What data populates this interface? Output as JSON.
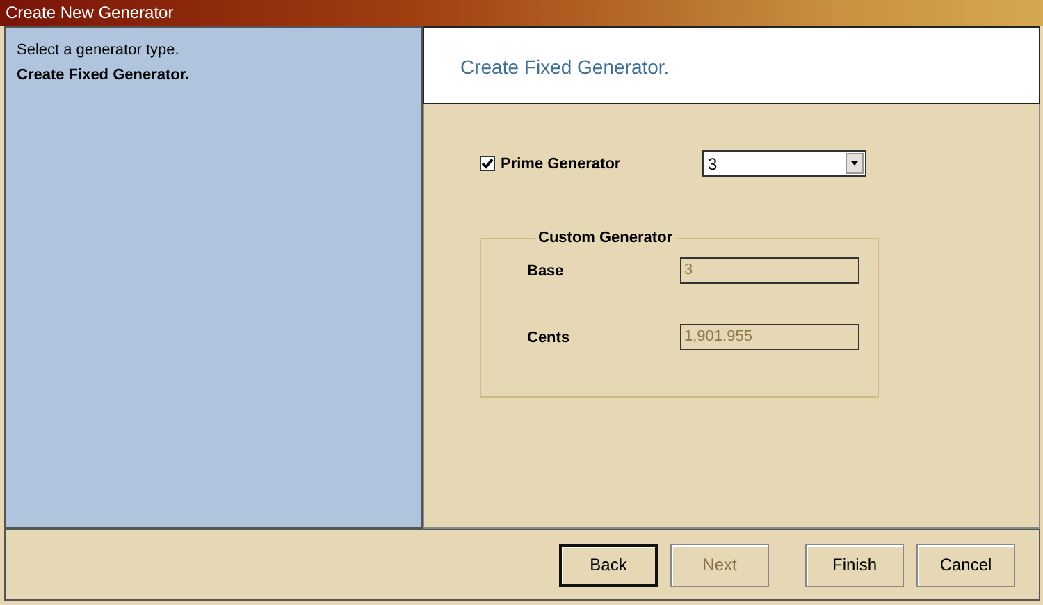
{
  "window": {
    "title": "Create New Generator"
  },
  "sidebar": {
    "prompt": "Select a generator type.",
    "items": [
      {
        "label": "Create Fixed Generator.",
        "selected": true
      }
    ]
  },
  "header": {
    "title": "Create Fixed Generator."
  },
  "prime": {
    "label": "Prime Generator",
    "checked": true,
    "value": "3"
  },
  "custom": {
    "title": "Custom Generator",
    "fields": [
      {
        "label": "Base",
        "value": "3",
        "disabled": true
      },
      {
        "label": "Cents",
        "value": "1,901.955",
        "disabled": true
      }
    ]
  },
  "buttons": [
    {
      "label": "Back",
      "default": true,
      "disabled": false
    },
    {
      "label": "Next",
      "default": false,
      "disabled": true
    },
    {
      "label": "Finish",
      "default": false,
      "disabled": false
    },
    {
      "label": "Cancel",
      "default": false,
      "disabled": false
    }
  ]
}
